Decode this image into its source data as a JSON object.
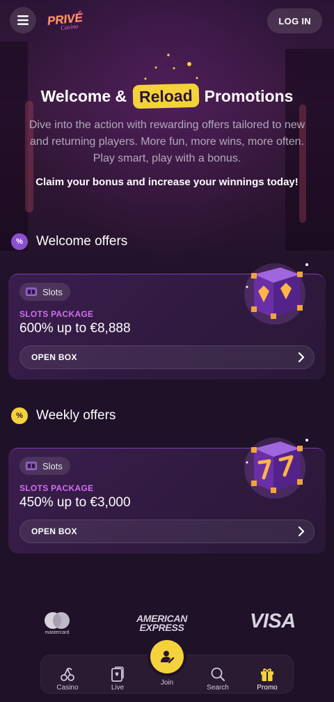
{
  "header": {
    "logo_text": "PRIVÉ",
    "logo_subtext": "Casino",
    "login_label": "LOG IN"
  },
  "hero": {
    "title_before": "Welcome &",
    "title_highlight": "Reload",
    "title_after": "Promotions",
    "description": "Dive into the action with rewarding offers tailored to new and returning players. More fun, more wins, more often. Play smart, play with a bonus.",
    "claim": "Claim your bonus and increase your winnings today!"
  },
  "sections": {
    "welcome": {
      "badge": "%",
      "title": "Welcome offers"
    },
    "weekly": {
      "badge": "%",
      "title": "Weekly offers"
    }
  },
  "offers": [
    {
      "category": "Slots",
      "package": "SLOTS PACKAGE",
      "amount": "600% up to €8,888",
      "button": "OPEN BOX"
    },
    {
      "category": "Slots",
      "package": "SLOTS PACKAGE",
      "amount": "450% up to €3,000",
      "button": "OPEN BOX"
    }
  ],
  "payments": {
    "mastercard_label": "mastercard",
    "amex_line1": "AMERICAN",
    "amex_line2": "EXPRESS",
    "visa_label": "VISA"
  },
  "nav": {
    "casino": "Casino",
    "live": "Live",
    "join": "Join",
    "search": "Search",
    "promo": "Promo"
  },
  "colors": {
    "accent_yellow": "#f4d23b",
    "accent_purple": "#d36ef0",
    "background": "#1e1128"
  }
}
